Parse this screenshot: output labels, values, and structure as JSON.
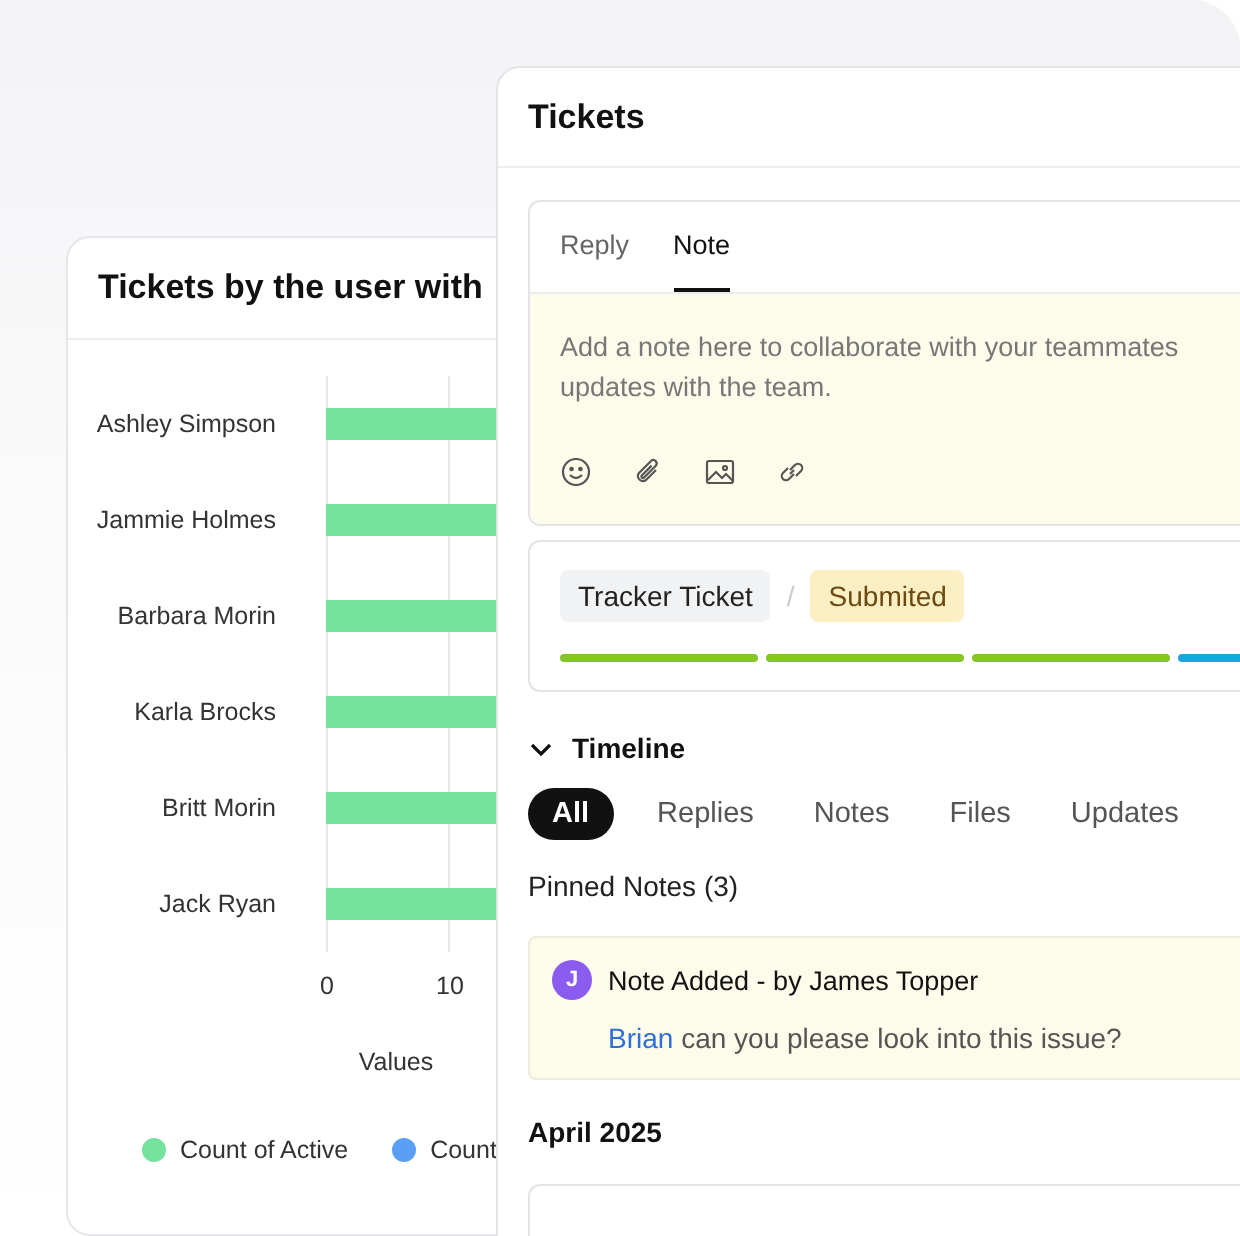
{
  "chart_card": {
    "title": "Tickets by the user with",
    "chart": {
      "categories": [
        "Ashley Simpson",
        "Jammie Holmes",
        "Barbara Morin",
        "Karla Brocks",
        "Britt Morin",
        "Jack Ryan"
      ],
      "ticks": [
        "0",
        "10"
      ],
      "axis_label": "Values",
      "legend": [
        {
          "name": "Count of Active",
          "color": "#74e19c"
        },
        {
          "name": "Count",
          "color": "#5b9ef5"
        }
      ]
    }
  },
  "tickets_panel": {
    "title": "Tickets",
    "editor": {
      "tabs": [
        {
          "label": "Reply",
          "selected": false
        },
        {
          "label": "Note",
          "selected": true
        }
      ],
      "placeholder": "Add a note here to collaborate with your teammates\nupdates with the team."
    },
    "tracker": {
      "type": "Tracker Ticket",
      "separator": "/",
      "status": "Submited",
      "segments": [
        {
          "color": "#84c529"
        },
        {
          "color": "#84c529"
        },
        {
          "color": "#84c529"
        },
        {
          "color": "#1ea4dc"
        }
      ]
    },
    "timeline": {
      "title": "Timeline",
      "expanded": true,
      "filters": [
        {
          "label": "All",
          "selected": true
        },
        {
          "label": "Replies",
          "selected": false
        },
        {
          "label": "Notes",
          "selected": false
        },
        {
          "label": "Files",
          "selected": false
        },
        {
          "label": "Updates",
          "selected": false
        }
      ],
      "pinned_title": "Pinned Notes (3)",
      "pinned": [
        {
          "avatar": "J",
          "heading": "Note Added - by James Topper",
          "mention": "Brian",
          "text": "can you please look into this issue?"
        }
      ],
      "month": "April 2025"
    }
  }
}
